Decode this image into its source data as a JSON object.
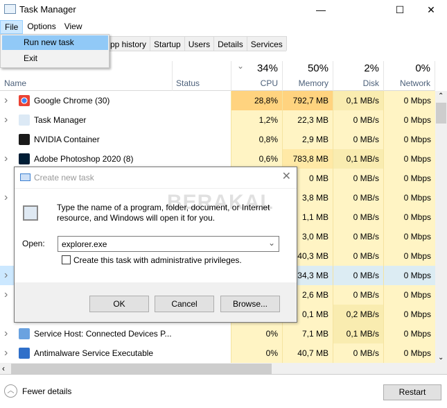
{
  "window": {
    "title": "Task Manager",
    "minimize": "—",
    "maximize": "☐",
    "close": "✕"
  },
  "menu": [
    "File",
    "Options",
    "View"
  ],
  "file_menu": [
    "Run new task",
    "Exit"
  ],
  "tabs": [
    "pp history",
    "Startup",
    "Users",
    "Details",
    "Services"
  ],
  "columns": {
    "name": "Name",
    "status": "Status",
    "cpu": {
      "pct": "34%",
      "label": "CPU"
    },
    "memory": {
      "pct": "50%",
      "label": "Memory"
    },
    "disk": {
      "pct": "2%",
      "label": "Disk"
    },
    "network": {
      "pct": "0%",
      "label": "Network"
    }
  },
  "heat_colors": {
    "low": "#fff4c4",
    "mid": "#f9ecb0",
    "high": "#ffe9a6",
    "max": "#ffd37f",
    "selected": "#dcecf3"
  },
  "rows": [
    {
      "name": "Google Chrome (30)",
      "icon": "chrome-icon",
      "expand": true,
      "cpu": "28,8%",
      "memory": "792,7 MB",
      "disk": "0,1 MB/s",
      "network": "0 Mbps",
      "heat": [
        "max",
        "max",
        "mid",
        "low"
      ]
    },
    {
      "name": "Task Manager",
      "icon": "task-manager-icon",
      "expand": true,
      "cpu": "1,2%",
      "memory": "22,3 MB",
      "disk": "0 MB/s",
      "network": "0 Mbps",
      "heat": [
        "low",
        "low",
        "low",
        "low"
      ]
    },
    {
      "name": "NVIDIA Container",
      "icon": "nvidia-icon",
      "expand": false,
      "cpu": "0,8%",
      "memory": "2,9 MB",
      "disk": "0 MB/s",
      "network": "0 Mbps",
      "heat": [
        "low",
        "low",
        "low",
        "low"
      ]
    },
    {
      "name": "Adobe Photoshop 2020 (8)",
      "icon": "photoshop-icon",
      "expand": true,
      "cpu": "0,6%",
      "memory": "783,8 MB",
      "disk": "0,1 MB/s",
      "network": "0 Mbps",
      "heat": [
        "low",
        "high",
        "mid",
        "low"
      ]
    },
    {
      "expand": false,
      "memory": "0 MB",
      "disk": "0 MB/s",
      "network": "0 Mbps",
      "heat": [
        "low",
        "low",
        "low",
        "low"
      ]
    },
    {
      "expand": true,
      "memory": "3,8 MB",
      "disk": "0 MB/s",
      "network": "0 Mbps",
      "heat": [
        "low",
        "low",
        "low",
        "low"
      ]
    },
    {
      "expand": false,
      "memory": "1,1 MB",
      "disk": "0 MB/s",
      "network": "0 Mbps",
      "heat": [
        "low",
        "low",
        "low",
        "low"
      ]
    },
    {
      "expand": false,
      "memory": "3,0 MB",
      "disk": "0 MB/s",
      "network": "0 Mbps",
      "heat": [
        "low",
        "low",
        "low",
        "low"
      ]
    },
    {
      "expand": false,
      "memory": "40,3 MB",
      "disk": "0 MB/s",
      "network": "0 Mbps",
      "heat": [
        "low",
        "low",
        "low",
        "low"
      ]
    },
    {
      "expand": true,
      "selected": true,
      "memory": "34,3 MB",
      "disk": "0 MB/s",
      "network": "0 Mbps",
      "heat": [
        "low",
        "low",
        "low",
        "low"
      ]
    },
    {
      "expand": true,
      "memory": "2,6 MB",
      "disk": "0 MB/s",
      "network": "0 Mbps",
      "heat": [
        "low",
        "low",
        "low",
        "low"
      ]
    },
    {
      "expand": false,
      "memory": "0,1 MB",
      "disk": "0,2 MB/s",
      "network": "0 Mbps",
      "heat": [
        "low",
        "low",
        "mid",
        "low"
      ]
    },
    {
      "name": "Service Host: Connected Devices P...",
      "icon": "gear-icon",
      "expand": true,
      "cpu": "0%",
      "memory": "7,1 MB",
      "disk": "0,1 MB/s",
      "network": "0 Mbps",
      "heat": [
        "low",
        "low",
        "mid",
        "low"
      ]
    },
    {
      "name": "Antimalware Service Executable",
      "icon": "antimalware-icon",
      "expand": true,
      "cpu": "0%",
      "memory": "40,7 MB",
      "disk": "0 MB/s",
      "network": "0 Mbps",
      "heat": [
        "low",
        "low",
        "low",
        "low"
      ]
    }
  ],
  "dialog": {
    "title": "Create new task",
    "message": "Type the name of a program, folder, document, or Internet resource, and Windows will open it for you.",
    "open_label": "Open:",
    "open_value": "explorer.exe",
    "checkbox_label": "Create this task with administrative privileges.",
    "checkbox_checked": false,
    "ok": "OK",
    "cancel": "Cancel",
    "browse": "Browse..."
  },
  "watermark": "BERAKAL",
  "footer": {
    "fewer_details": "Fewer details",
    "restart": "Restart"
  }
}
